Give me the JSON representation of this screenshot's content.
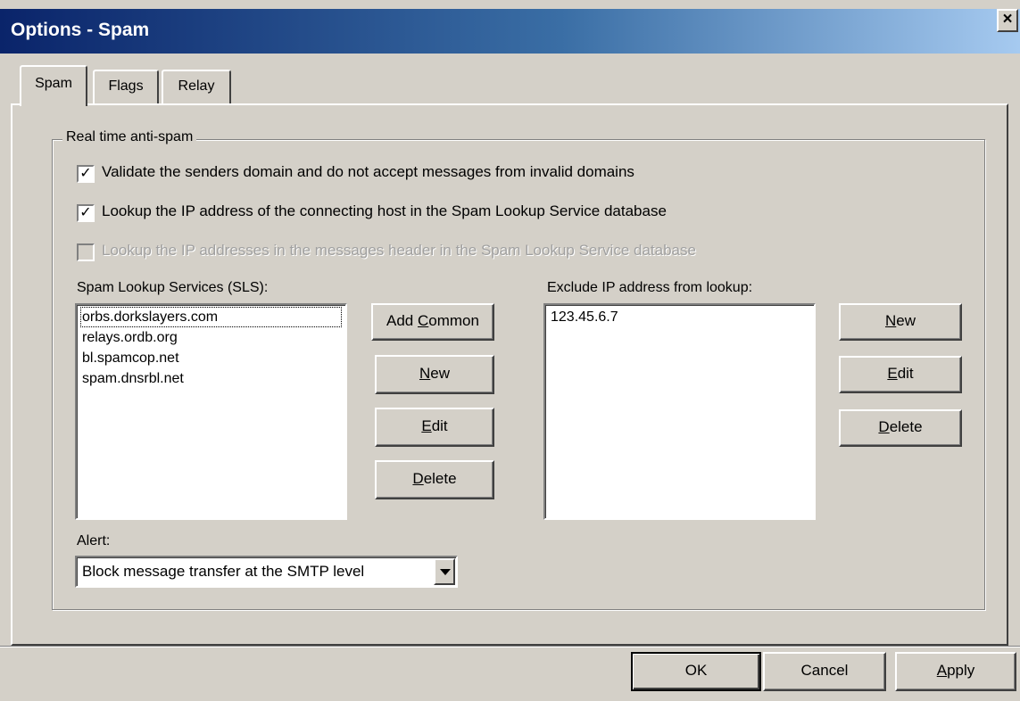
{
  "window": {
    "title": "Options - Spam",
    "close_label": "×"
  },
  "tabs": [
    {
      "label": "Spam",
      "active": true
    },
    {
      "label": "Flags",
      "active": false
    },
    {
      "label": "Relay",
      "active": false
    }
  ],
  "anti_spam": {
    "group_label": "Real time anti-spam",
    "checkboxes": [
      {
        "label": "Validate the senders domain and do not accept messages from invalid domains",
        "checked": true,
        "enabled": true
      },
      {
        "label": "Lookup the IP address of the connecting host in the Spam Lookup Service database",
        "checked": true,
        "enabled": true
      },
      {
        "label": "Lookup the IP addresses in the messages header in the Spam Lookup Service database",
        "checked": false,
        "enabled": false
      }
    ],
    "check_mark": "✓",
    "sls": {
      "label": "Spam Lookup Services (SLS):",
      "items": [
        "orbs.dorkslayers.com",
        "relays.ordb.org",
        "bl.spamcop.net",
        "spam.dnsrbl.net"
      ],
      "buttons": {
        "add_common_pre": "Add ",
        "add_common_ul": "C",
        "add_common_post": "ommon",
        "new_ul": "N",
        "new_post": "ew",
        "edit_ul": "E",
        "edit_post": "dit",
        "delete_ul": "D",
        "delete_post": "elete"
      }
    },
    "exclude": {
      "label": "Exclude IP address from lookup:",
      "items": [
        "123.45.6.7"
      ],
      "buttons": {
        "new_ul": "N",
        "new_post": "ew",
        "edit_ul": "E",
        "edit_post": "dit",
        "delete_ul": "D",
        "delete_post": "elete"
      }
    },
    "alert": {
      "label": "Alert:",
      "selected": "Block message transfer at the SMTP level"
    }
  },
  "footer": {
    "ok": "OK",
    "cancel": "Cancel",
    "apply_ul": "A",
    "apply_post": "pply"
  }
}
